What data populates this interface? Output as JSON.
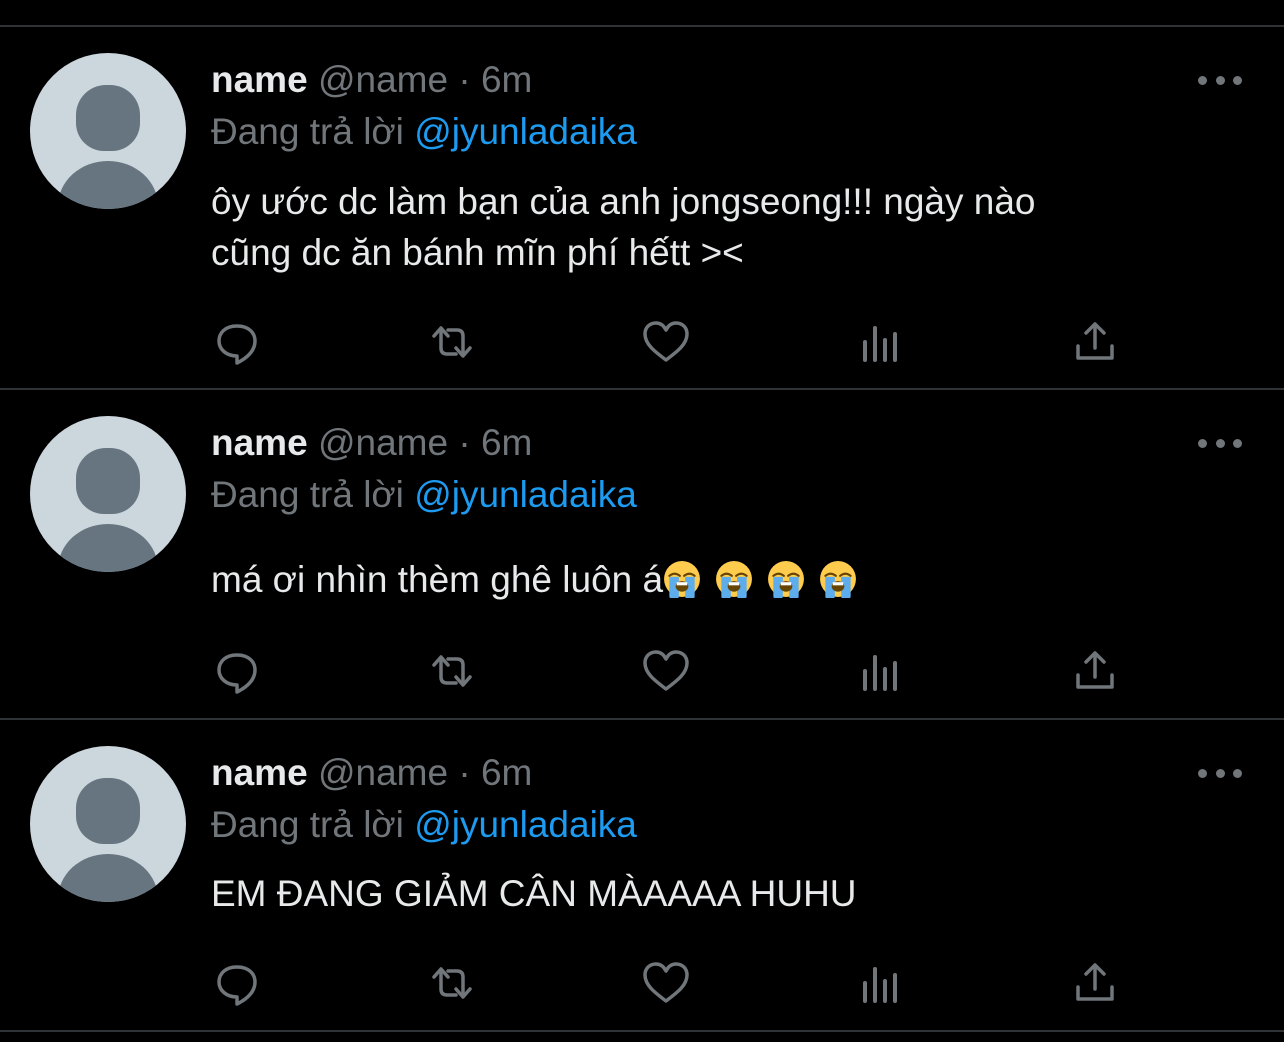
{
  "tweets": [
    {
      "display_name": "name",
      "handle": "@name",
      "separator": "·",
      "time": "6m",
      "reply_prefix": "Đang trả lời",
      "reply_to": "@jyunladaika",
      "text_lines": [
        "ôy ước dc làm bạn của anh jongseong!!! ngày nào",
        "cũng dc ăn bánh mĩn phí hếtt ><"
      ],
      "emoji_count": 0
    },
    {
      "display_name": "name",
      "handle": "@name",
      "separator": "·",
      "time": "6m",
      "reply_prefix": "Đang trả lời",
      "reply_to": "@jyunladaika",
      "text_lines": [
        "má ơi nhìn thèm ghê luôn á"
      ],
      "emoji": "loudly-crying-face",
      "emoji_count": 4
    },
    {
      "display_name": "name",
      "handle": "@name",
      "separator": "·",
      "time": "6m",
      "reply_prefix": "Đang trả lời",
      "reply_to": "@jyunladaika",
      "text_lines": [
        "EM ĐANG GIẢM CÂN MÀAAAA HUHU"
      ],
      "emoji_count": 0
    }
  ],
  "actions": [
    "reply-icon",
    "retweet-icon",
    "like-icon",
    "analytics-icon",
    "share-icon"
  ],
  "colors": {
    "background": "#000000",
    "divider": "#2f3336",
    "primary_text": "#e7e9ea",
    "secondary_text": "#71767b",
    "link": "#1d9bf0",
    "avatar_bg": "#ccd6dd",
    "avatar_fg": "#66757f"
  }
}
